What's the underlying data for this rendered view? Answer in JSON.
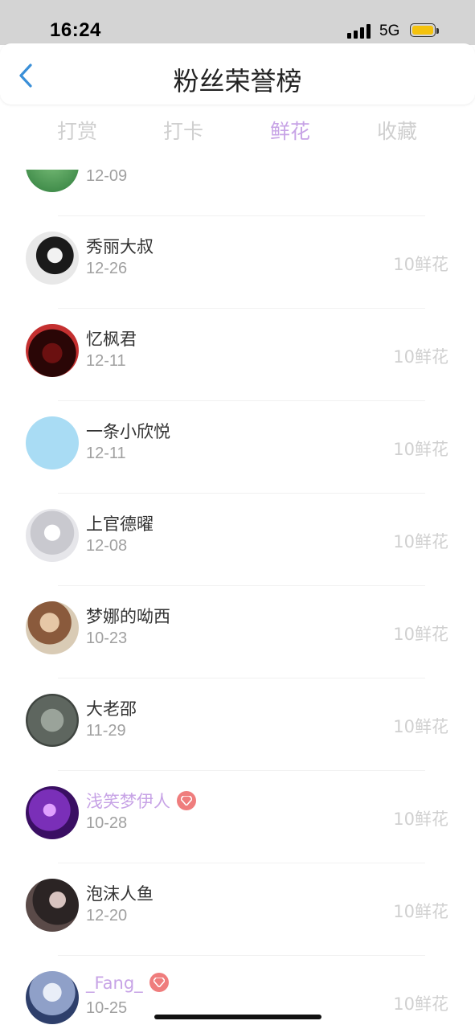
{
  "status": {
    "time": "16:24",
    "network": "5G"
  },
  "header": {
    "title": "粉丝荣誉榜"
  },
  "tabs": [
    {
      "label": "打赏",
      "active": false
    },
    {
      "label": "打卡",
      "active": false
    },
    {
      "label": "鲜花",
      "active": true
    },
    {
      "label": "收藏",
      "active": false
    }
  ],
  "list": {
    "partial_top": {
      "date": "12-09"
    },
    "rows": [
      {
        "name": "秀丽大叔",
        "date": "12-26",
        "amount": "10鲜花",
        "vip": false
      },
      {
        "name": "忆枫君",
        "date": "12-11",
        "amount": "10鲜花",
        "vip": false
      },
      {
        "name": "一条小欣悦",
        "date": "12-11",
        "amount": "10鲜花",
        "vip": false
      },
      {
        "name": "上官德曜",
        "date": "12-08",
        "amount": "10鲜花",
        "vip": false
      },
      {
        "name": "梦娜的呦西",
        "date": "10-23",
        "amount": "10鲜花",
        "vip": false
      },
      {
        "name": "大老邵",
        "date": "11-29",
        "amount": "10鲜花",
        "vip": false
      },
      {
        "name": "浅笑梦伊人",
        "date": "10-28",
        "amount": "10鲜花",
        "vip": true
      },
      {
        "name": "泡沫人鱼",
        "date": "12-20",
        "amount": "10鲜花",
        "vip": false
      },
      {
        "name": "_Fang_",
        "date": "10-25",
        "amount": "10鲜花",
        "vip": true
      }
    ]
  },
  "colors": {
    "accent": "#c7a3e6",
    "back_arrow": "#3a8fd8",
    "vip_badge": "#ef7d7d"
  },
  "icons": {
    "back": "chevron-left-icon",
    "vip": "diamond-icon"
  }
}
